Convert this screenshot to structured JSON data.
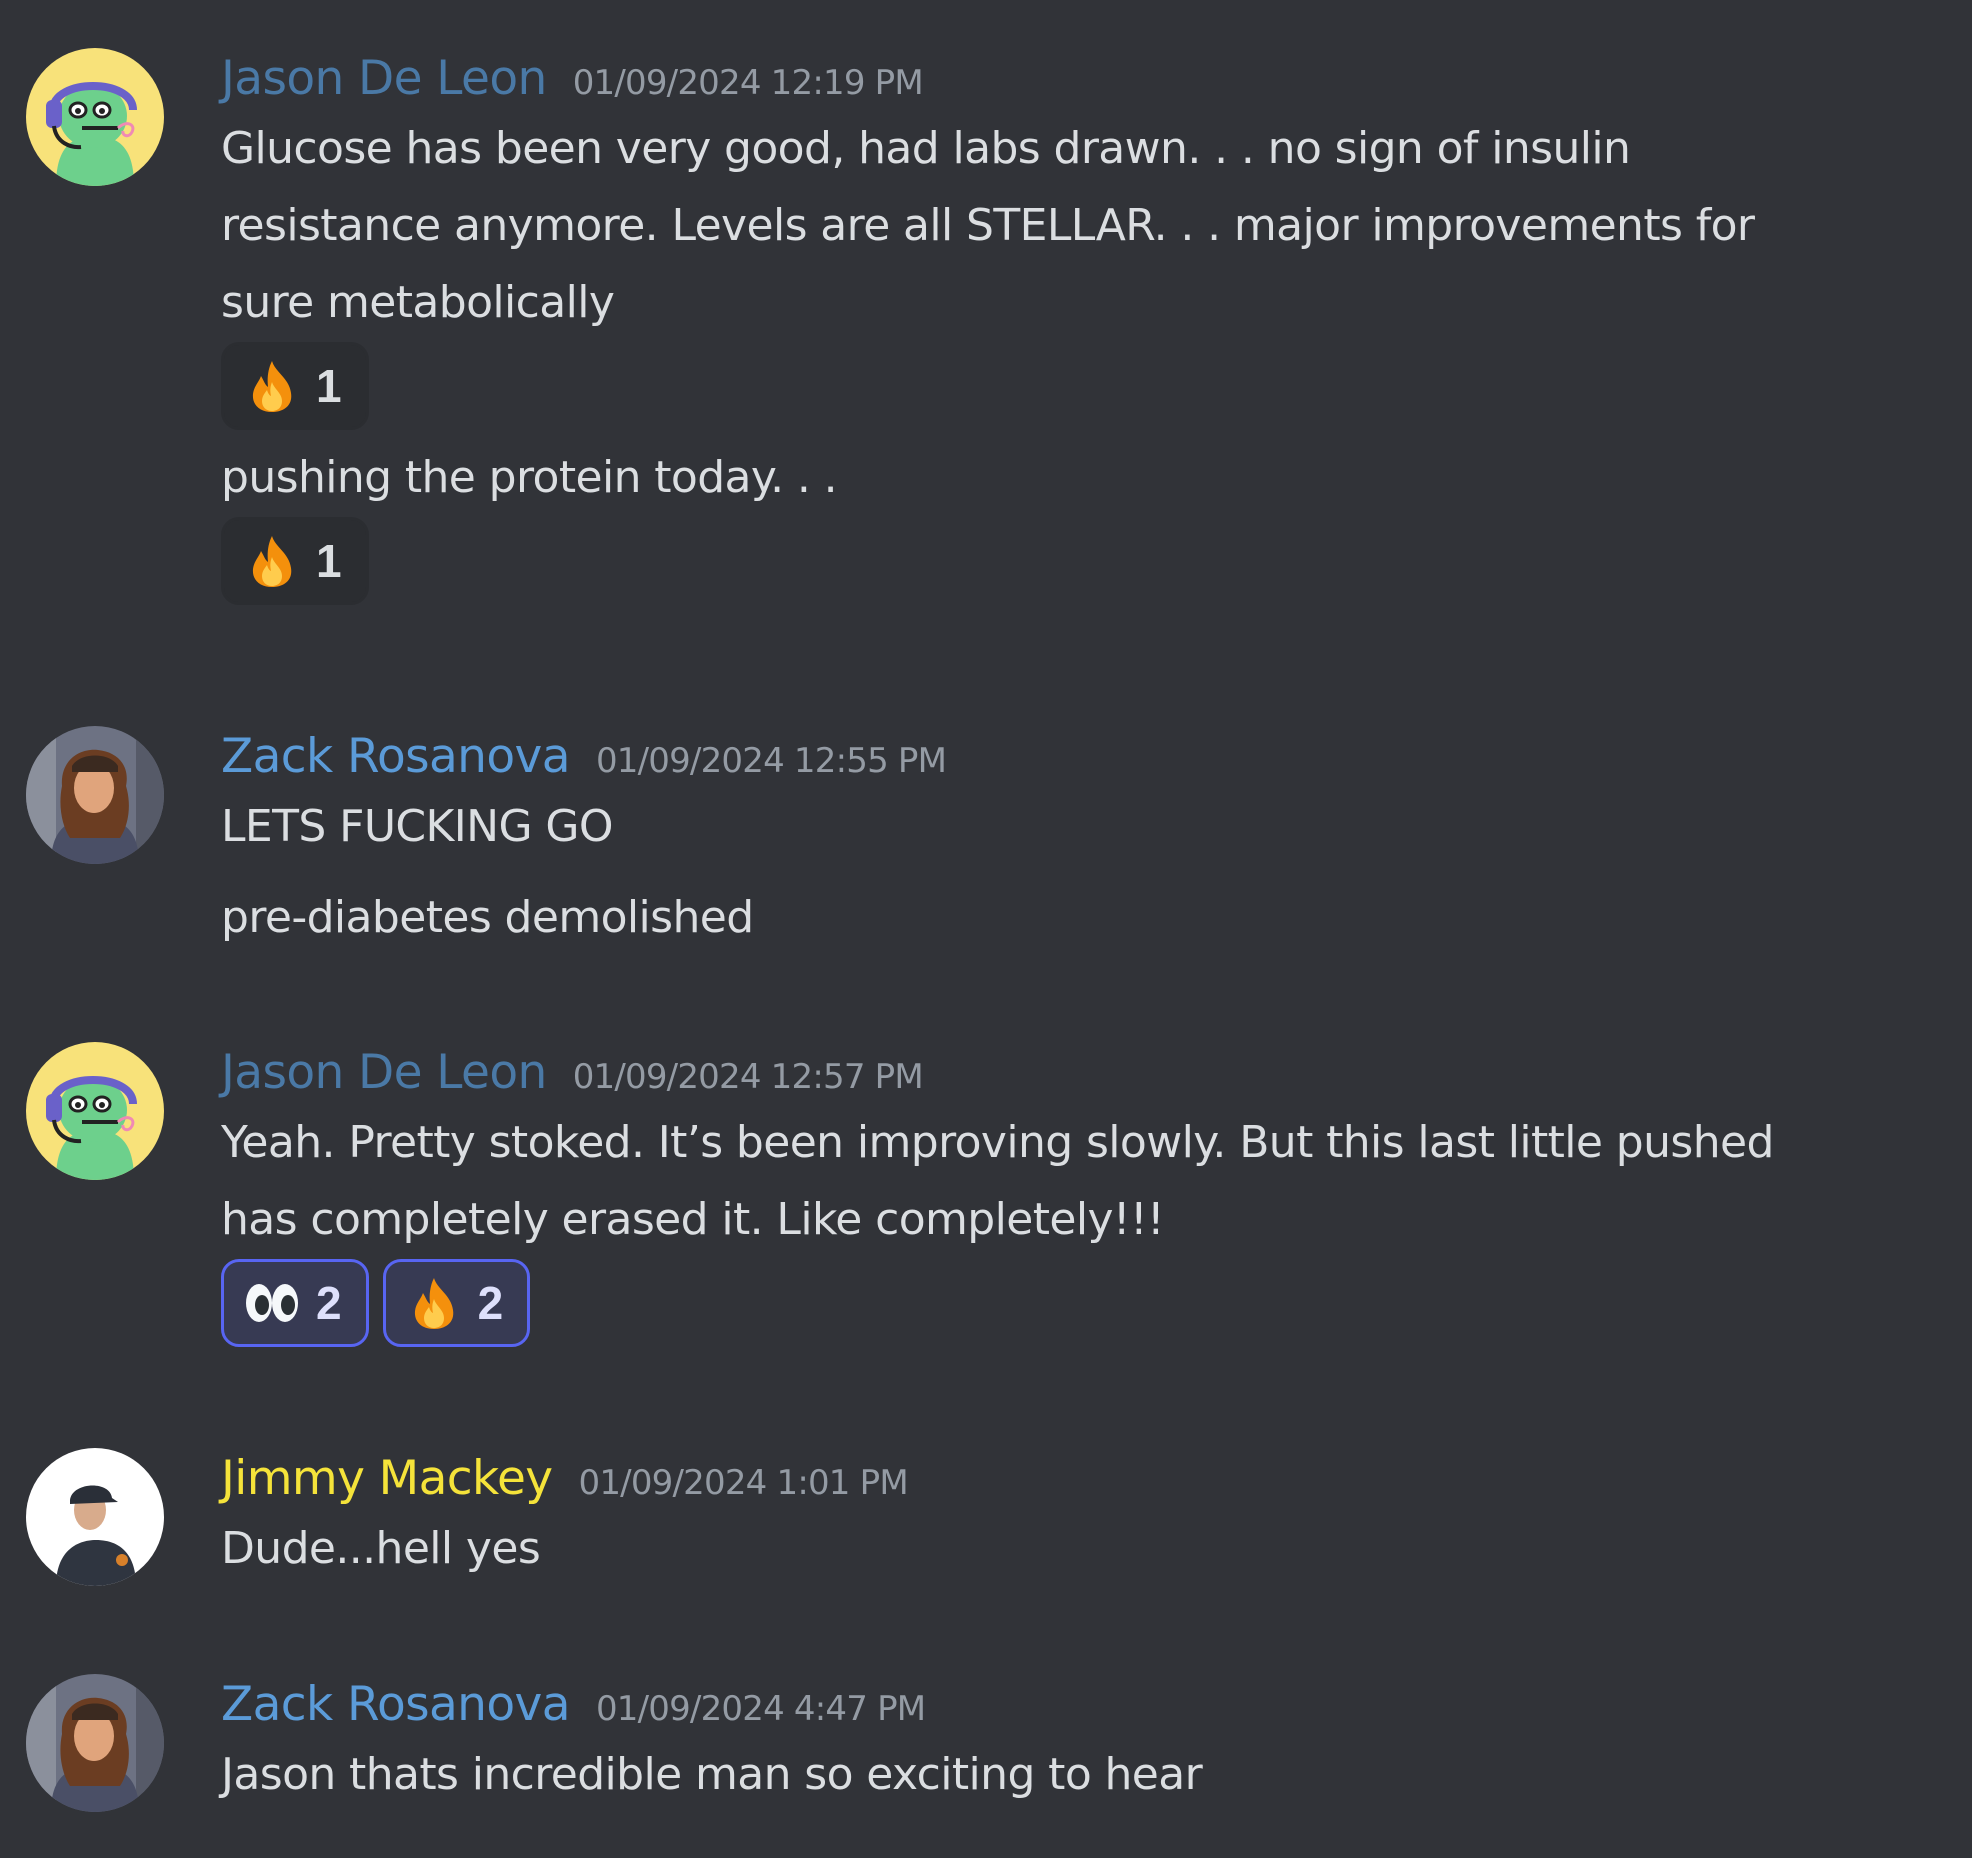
{
  "colors": {
    "background": "#313338",
    "jason_name": "#4a79a6",
    "zack_name": "#5b9bd8",
    "jimmy_name": "#f5e33a",
    "timestamp": "#949ba4",
    "reaction_bg": "#2b2d31",
    "reaction_me_bg": "#373a53",
    "reaction_me_border": "#5865f2"
  },
  "messages": [
    {
      "author": "Jason De Leon",
      "timestamp": "01/09/2024 12:19 PM",
      "avatar_icon": "cartoon-headset-avatar",
      "lines": [
        "Glucose has been very good, had labs drawn. . . no sign of insulin",
        "resistance anymore.  Levels are all STELLAR. . . major improvements for",
        "sure metabolically"
      ],
      "reactions_1": [
        {
          "emoji": "fire",
          "count": "1"
        }
      ],
      "followup": "pushing the protein today. . .",
      "reactions_2": [
        {
          "emoji": "fire",
          "count": "1"
        }
      ]
    },
    {
      "author": "Zack Rosanova",
      "timestamp": "01/09/2024 12:55 PM",
      "avatar_icon": "photo-avatar",
      "line1": "LETS FUCKING GO",
      "line2": "pre-diabetes demolished"
    },
    {
      "author": "Jason De Leon",
      "timestamp": "01/09/2024 12:57 PM",
      "avatar_icon": "cartoon-headset-avatar",
      "lines": [
        "Yeah. Pretty stoked. It’s been improving slowly. But this last little pushed",
        "has completely erased it. Like completely!!!"
      ],
      "reactions": [
        {
          "emoji": "eyes",
          "count": "2"
        },
        {
          "emoji": "fire",
          "count": "2"
        }
      ]
    },
    {
      "author": "Jimmy Mackey",
      "timestamp": "01/09/2024 1:01 PM",
      "avatar_icon": "photo-avatar",
      "line1": "Dude...hell yes"
    },
    {
      "author": "Zack Rosanova",
      "timestamp": "01/09/2024 4:47 PM",
      "avatar_icon": "photo-avatar",
      "line1": "Jason thats incredible man so exciting to hear"
    }
  ]
}
